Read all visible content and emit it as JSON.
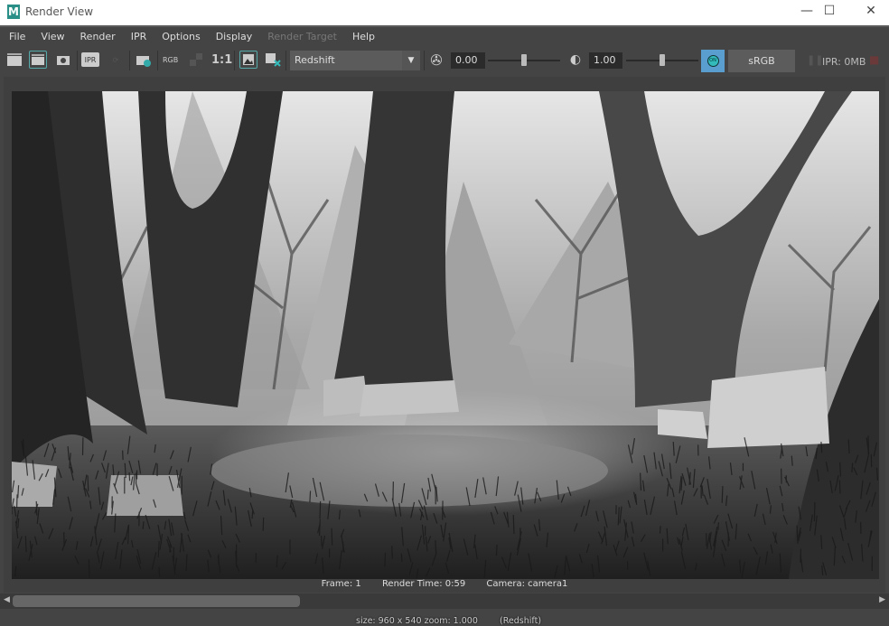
{
  "window": {
    "title": "Render View",
    "logo": "M",
    "controls": [
      "minimize",
      "maximize",
      "close"
    ]
  },
  "menu": [
    {
      "label": "File"
    },
    {
      "label": "View"
    },
    {
      "label": "Render"
    },
    {
      "label": "IPR"
    },
    {
      "label": "Options"
    },
    {
      "label": "Display"
    },
    {
      "label": "Render Target",
      "disabled": true
    },
    {
      "label": "Help"
    }
  ],
  "toolbar": {
    "icons": [
      "redo-render-icon",
      "render-region-icon",
      "snapshot-icon",
      "ipr-render-icon",
      "refresh-ipr-icon",
      "render-settings-icon",
      "rgb-channels-icon",
      "checker-icon",
      "real-size-icon",
      "keep-image-icon",
      "remove-image-icon"
    ],
    "rgb_label": "RGB",
    "real_size_label": "1:1",
    "ipr_label": "IPR",
    "renderer": "Redshift",
    "exposure": "0.00",
    "exposure_level": 0.5,
    "gamma": "1.00",
    "gamma_level": 0.5,
    "color_mgmt_on": "ON",
    "view_transform": "sRGB gamma",
    "ipr_memory": "IPR: 0MB"
  },
  "image": {
    "size_info": "size: 960 x 540 zoom: 1.000",
    "renderer_info": "(Redshift)"
  },
  "status": {
    "frame": "Frame: 1",
    "render_time": "Render Time: 0:59",
    "camera": "Camera: camera1"
  },
  "scrollbar": {
    "position": 0,
    "visible_fraction": 0.33
  }
}
